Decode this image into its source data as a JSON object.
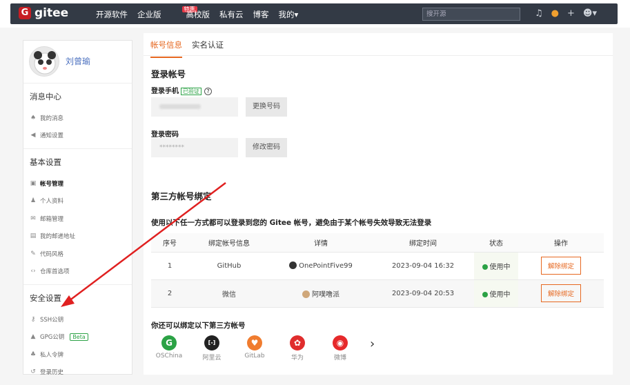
{
  "topbar": {
    "brand": "gitee",
    "nav": [
      "开源软件",
      "企业版",
      "高校版",
      "私有云",
      "博客",
      "我的▾"
    ],
    "hot_badge": "特惠",
    "search_placeholder": "搜开源"
  },
  "sidebar": {
    "username": "刘曾瑜",
    "sections": [
      {
        "title": "消息中心",
        "items": [
          {
            "icon": "bell-icon",
            "label": "我的消息"
          },
          {
            "icon": "speaker-icon",
            "label": "通知设置"
          }
        ]
      },
      {
        "title": "基本设置",
        "items": [
          {
            "icon": "id-card-icon",
            "label": "帐号管理"
          },
          {
            "icon": "person-icon",
            "label": "个人资料"
          },
          {
            "icon": "mail-icon",
            "label": "邮箱管理"
          },
          {
            "icon": "address-icon",
            "label": "我的邮递地址"
          },
          {
            "icon": "brush-icon",
            "label": "代码风格"
          },
          {
            "icon": "code-icon",
            "label": "仓库首选项"
          }
        ]
      },
      {
        "title": "安全设置",
        "items": [
          {
            "icon": "key-icon",
            "label": "SSH公钥"
          },
          {
            "icon": "lock-icon",
            "label": "GPG公钥",
            "badge": "Beta"
          },
          {
            "icon": "token-icon",
            "label": "私人令牌"
          },
          {
            "icon": "history-icon",
            "label": "登录历史"
          }
        ]
      }
    ]
  },
  "main": {
    "tabs": [
      "帐号信息",
      "实名认证"
    ],
    "login_title": "登录帐号",
    "phone_label": "登录手机",
    "verified": "已验证",
    "change_phone": "更换号码",
    "password_label": "登录密码",
    "password_value": "********",
    "change_password": "修改密码",
    "third_title": "第三方帐号绑定",
    "third_desc": "使用以下任一方式都可以登录到您的 Gitee 帐号，避免由于某个帐号失效导致无法登录",
    "table": {
      "headers": [
        "序号",
        "绑定帐号信息",
        "详情",
        "绑定时间",
        "状态",
        "操作"
      ],
      "rows": [
        {
          "no": "1",
          "platform": "GitHub",
          "detail": "OnePointFive99",
          "time": "2023-09-04 16:32",
          "status": "使用中",
          "action": "解除绑定"
        },
        {
          "no": "2",
          "platform": "微信",
          "detail": "阿噗噜派",
          "time": "2023-09-04 20:53",
          "status": "使用中",
          "action": "解除绑定"
        }
      ]
    },
    "more_title": "你还可以绑定以下第三方帐号",
    "providers": [
      {
        "name": "OSChina",
        "color": "#2ba245",
        "glyph": "G"
      },
      {
        "name": "阿里云",
        "color": "#222222",
        "glyph": "[-]"
      },
      {
        "name": "GitLab",
        "color": "#f07c2f",
        "glyph": "♥"
      },
      {
        "name": "华为",
        "color": "#e02d2d",
        "glyph": "✿"
      },
      {
        "name": "微博",
        "color": "#e6292b",
        "glyph": "◉"
      }
    ]
  },
  "colors": {
    "accent": "#e6671f",
    "success": "#2ba245",
    "topbar": "#333a45",
    "annotation_arrow": "#e02020"
  }
}
